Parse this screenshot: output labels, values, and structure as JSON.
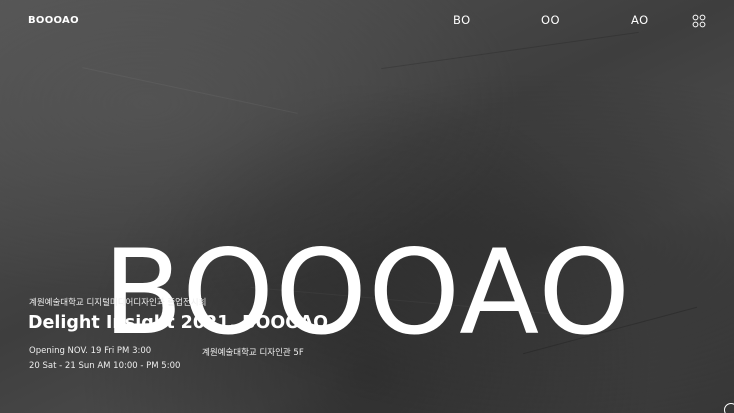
{
  "header": {
    "logo": "BOOOAO",
    "nav": [
      "BO",
      "OO",
      "AO"
    ],
    "menu_icon": "grid-circles-icon"
  },
  "hero": {
    "title": "BOOOAO"
  },
  "exhibition": {
    "subtitle": "계원예술대학교 디지털미디어디자인과 졸업전시회",
    "title": "Delight Insight 2021, BOOOAO",
    "opening": "Opening NOV. 19 Fri PM 3:00",
    "hours": "20 Sat - 21 Sun AM 10:00 - PM 5:00",
    "venue": "계원예술대학교 디자인관 5F"
  },
  "colors": {
    "background": "#4a4a4a",
    "text": "#ffffff"
  }
}
